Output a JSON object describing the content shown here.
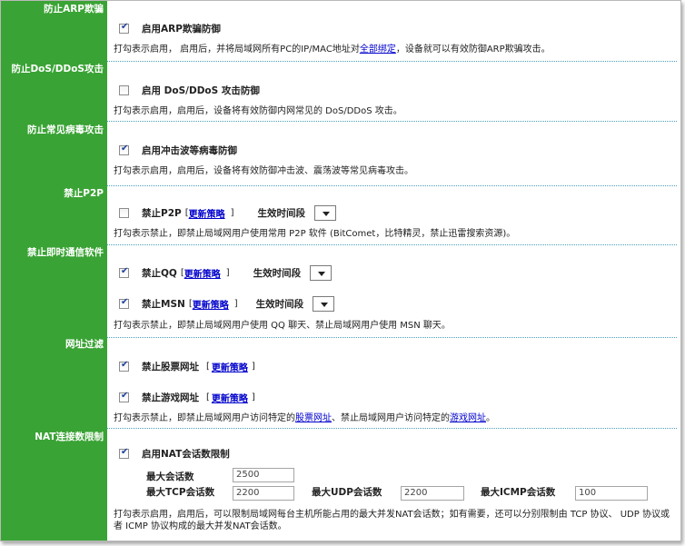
{
  "categories": {
    "arp": "防止ARP欺骗",
    "dos": "防止DoS/DDoS攻击",
    "virus": "防止常见病毒攻击",
    "p2p": "禁止P2P",
    "im": "禁止即时通信软件",
    "url": "网址过滤",
    "nat": "NAT连接数限制"
  },
  "arp": {
    "checked": true,
    "label": "启用ARP欺骗防御",
    "desc_pre": "打勾表示启用，  启用后，并将局域网所有PC的IP/MAC地址对",
    "desc_link": "全部绑定",
    "desc_post": "，设备就可以有效防御ARP欺骗攻击。"
  },
  "dos": {
    "checked": false,
    "label": "启用  DoS/DDoS 攻击防御",
    "desc": "打勾表示启用，启用后，设备将有效防御内网常见的  DoS/DDoS 攻击。"
  },
  "virus": {
    "checked": true,
    "label": "启用冲击波等病毒防御",
    "desc": "打勾表示启用，启用后，设备将有效防御冲击波、震荡波等常见病毒攻击。"
  },
  "p2p": {
    "checked": false,
    "label": "禁止P2P",
    "bracket_open": "[",
    "policy_link": "更新策略",
    "bracket_close": "]",
    "time_label": "生效时间段",
    "desc": "打勾表示禁止，即禁止局域网用户使用常用  P2P 软件 (BitComet，比特精灵，禁止迅雷搜索资源)。"
  },
  "im": {
    "qq": {
      "checked": true,
      "label": "禁止QQ",
      "bracket_open": "[",
      "policy_link": "更新策略",
      "bracket_close": "]",
      "time_label": "生效时间段"
    },
    "msn": {
      "checked": true,
      "label": "禁止MSN",
      "bracket_open": "[",
      "policy_link": "更新策略",
      "bracket_close": "]",
      "time_label": "生效时间段"
    },
    "desc": "打勾表示禁止，即禁止局域网用户使用  QQ 聊天、禁止局域网用户使用  MSN 聊天。"
  },
  "url": {
    "stock": {
      "checked": true,
      "label": "禁止股票网址",
      "bracket_open": "[",
      "policy_link": "更新策略",
      "bracket_close": "]"
    },
    "game": {
      "checked": true,
      "label": "禁止游戏网址",
      "bracket_open": "[",
      "policy_link": "更新策略",
      "bracket_close": "]"
    },
    "desc_pre": "打勾表示禁止，即禁止局域网用户访问特定的",
    "desc_link1": "股票网址",
    "desc_mid": "、禁止局域网用户访问特定的",
    "desc_link2": "游戏网址",
    "desc_post": "。"
  },
  "nat": {
    "checked": true,
    "label": "启用NAT会话数限制",
    "max_sessions_label": "最大会话数",
    "max_sessions_value": "2500",
    "max_tcp_label": "最大TCP会话数",
    "max_tcp_value": "2200",
    "max_udp_label": "最大UDP会话数",
    "max_udp_value": "2200",
    "max_icmp_label": "最大ICMP会话数",
    "max_icmp_value": "100",
    "desc": "打勾表示启用，启用后，可以限制局域网每台主机所能占用的最大并发NAT会话数；如有需要，还可以分别限制由  TCP 协议、  UDP 协议或者  ICMP 协议构成的最大并发NAT会话数。"
  }
}
